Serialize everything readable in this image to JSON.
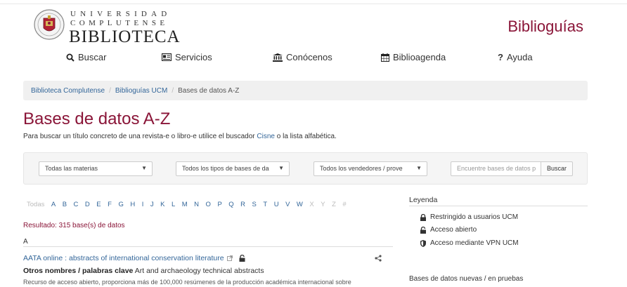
{
  "header": {
    "univ_line": "UNIVERSIDAD",
    "compl_line": "COMPLUTENSE",
    "biblio_line": "BIBLIOTECA",
    "site_title": "Biblioguías"
  },
  "nav": {
    "buscar": "Buscar",
    "servicios": "Servicios",
    "conocenos": "Conócenos",
    "biblioagenda": "Biblioagenda",
    "ayuda": "Ayuda"
  },
  "breadcrumb": {
    "items": [
      "Biblioteca Complutense",
      "Biblioguías UCM",
      "Bases de datos A-Z"
    ]
  },
  "page": {
    "title": "Bases de datos A-Z",
    "intro_before": "Para buscar un título concreto de una revista-e o libro-e utilice el buscador ",
    "intro_link": "Cisne",
    "intro_after": " o la lista alfabética."
  },
  "filters": {
    "materias": "Todas las materias",
    "tipos": "Todos los tipos de bases de da",
    "vendedores": "Todos los vendedores / prove",
    "search_placeholder": "Encuentre bases de datos p",
    "search_button": "Buscar"
  },
  "alphabet": {
    "all": "Todas",
    "letters": [
      "A",
      "B",
      "C",
      "D",
      "E",
      "F",
      "G",
      "H",
      "I",
      "J",
      "K",
      "L",
      "M",
      "N",
      "O",
      "P",
      "Q",
      "R",
      "S",
      "T",
      "U",
      "V",
      "W",
      "X",
      "Y",
      "Z",
      "#"
    ],
    "dim_letters": [
      "X",
      "Y",
      "Z",
      "#"
    ]
  },
  "results": {
    "count_text": "Resultado: 315 base(s) de datos",
    "current_letter": "A"
  },
  "entry": {
    "title": "AATA online : abstracts of international conservation literature",
    "alt_label": "Otros nombres / palabras clave",
    "alt_value": " Art and archaeology technical abstracts",
    "description": "Recurso de acceso abierto, proporciona más de 100,000 resúmenes de la producción académica internacional sobre"
  },
  "legend": {
    "title": "Leyenda",
    "restricted": "Restringido a usuarios UCM",
    "open": "Acceso abierto",
    "vpn": "Acceso mediante VPN UCM"
  },
  "sidebar": {
    "nuevas": "Bases de datos nuevas / en pruebas"
  },
  "colors": {
    "brand": "#8a1538",
    "link": "#336699"
  }
}
